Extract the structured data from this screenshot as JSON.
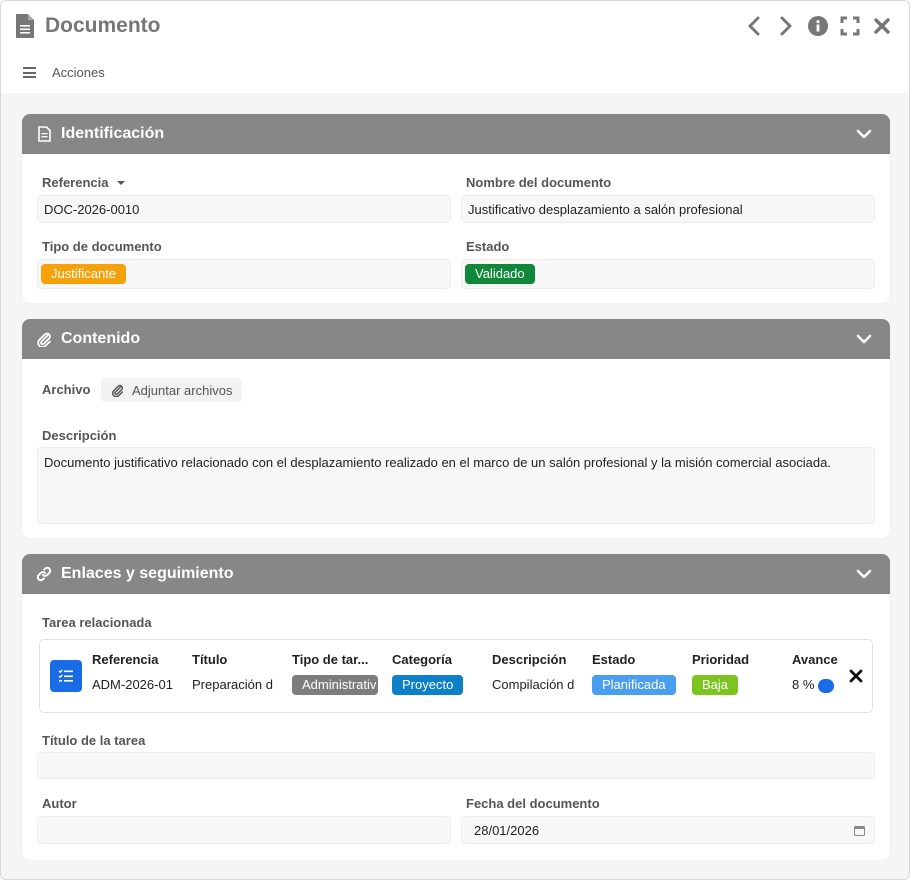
{
  "window": {
    "title": "Documento",
    "actions_label": "Acciones"
  },
  "sections": {
    "identification": {
      "title": "Identificación",
      "reference_label": "Referencia",
      "reference_value": "DOC-2026-0010",
      "name_label": "Nombre del documento",
      "name_value": "Justificativo desplazamiento a salón profesional",
      "type_label": "Tipo de documento",
      "type_value": "Justificante",
      "type_color": "#f5a20a",
      "state_label": "Estado",
      "state_value": "Validado",
      "state_color": "#10883a"
    },
    "content": {
      "title": "Contenido",
      "file_label": "Archivo",
      "attach_label": "Adjuntar archivos",
      "description_label": "Descripción",
      "description_value": "Documento justificativo relacionado con el desplazamiento realizado en el marco de un salón profesional y la misión comercial asociada."
    },
    "links": {
      "title": "Enlaces y seguimiento",
      "task_label": "Tarea relacionada",
      "task": {
        "headers": [
          "Referencia",
          "Título",
          "Tipo de tar...",
          "Categoría",
          "Descripción",
          "Estado",
          "Prioridad",
          "Avance"
        ],
        "reference": "ADM-2026-01",
        "title": "Preparación d",
        "type": "Administrativ",
        "type_color": "#7d7d7d",
        "category": "Proyecto",
        "category_color": "#0e7fc9",
        "description": "Compilación d",
        "state": "Planificada",
        "state_color": "#4a9ef0",
        "priority": "Baja",
        "priority_color": "#7cc520",
        "progress": "8 %"
      },
      "task_title_label": "Título de la tarea",
      "task_title_value": "",
      "author_label": "Autor",
      "author_value": "",
      "date_label": "Fecha del documento",
      "date_value": "28/01/2026"
    }
  },
  "icons": {
    "title": "document-icon",
    "prev": "chevron-left-icon",
    "next": "chevron-right-icon",
    "info": "info-icon",
    "fullscreen": "fullscreen-icon",
    "close": "close-icon",
    "menu": "hamburger-icon",
    "collapse": "chevron-down-icon",
    "attach": "paperclip-icon",
    "link": "link-icon",
    "task": "task-list-icon",
    "calendar": "calendar-icon",
    "dropdown": "caret-down-icon"
  }
}
